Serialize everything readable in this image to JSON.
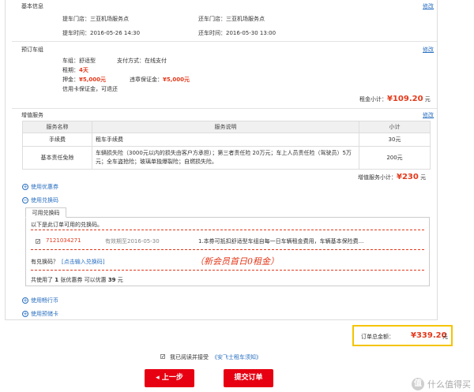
{
  "basic_info": {
    "title": "基本信息",
    "edit": "修改",
    "pickup_store": "提车门店：三亚机场服务点",
    "return_store": "还车门店：三亚机场服务点",
    "pickup_time": "提车时间：2016-05-26 14:30",
    "return_time": "还车时间：2016-05-30 13:00"
  },
  "vehicle": {
    "title": "预订车组",
    "edit": "修改",
    "group_label": "车组：",
    "group_value": "舒适型",
    "pay_label": "支付方式：",
    "pay_value": "在线支付",
    "lease_label": "租期：",
    "lease_value": "4天",
    "deposit_label": "押金：",
    "deposit_value": "¥5,000元",
    "violation_label": "违章保证金：",
    "violation_value": "¥5,000元",
    "note": "信用卡保证金，可退还",
    "subtotal_label": "租金小计：",
    "subtotal_value": "¥109.20",
    "subtotal_unit": "元"
  },
  "value_added": {
    "title": "增值服务",
    "edit": "修改",
    "headers": [
      "服务名称",
      "服务说明",
      "小计"
    ],
    "rows": [
      {
        "name": "手续费",
        "desc": "租车手续费",
        "price": "30元"
      },
      {
        "name": "基本责任免除",
        "desc": "车辆损失险（3000元以内的损失由客户方承担）；第三者责任险 20万元；车上人员责任险（驾驶员）5万元；全车盗抢险；玻璃单独爆裂险；自燃损失险。",
        "price": "200元"
      }
    ],
    "subtotal_label": "增值服务小计：",
    "subtotal_value": "¥230",
    "subtotal_unit": "元"
  },
  "coupons": {
    "use_coupon": "使用优惠券",
    "use_code": "使用兑换码",
    "tab_label": "可用兑换码",
    "intro": "以下是此订单可用的兑换码。",
    "code": "7121034271",
    "checked": true,
    "validity": "有效期至2016-05-30",
    "description": "1.本券可抵扣舒适型车组自每一日车辆租金费用，车辆基本保险费...",
    "has_code_label": "有兑换码？",
    "enter_code_link": "[点击输入兑换码]",
    "annotation": "（新会员首日0租金）",
    "summary_prefix": "共使用了",
    "summary_count": "1",
    "summary_middle": "张优惠券 可以优惠",
    "summary_amount": "39",
    "summary_unit": "元",
    "use_travel_coin": "使用畅行币",
    "use_prepaid_card": "使用预储卡"
  },
  "order_total": {
    "label": "订单总金额：",
    "value": "¥339.20",
    "unit": "元"
  },
  "agreement": {
    "checked": true,
    "text": "我已阅读并接受",
    "link": "《安飞士租车须知》"
  },
  "buttons": {
    "prev": "◂ 上一步",
    "submit": "提交订单"
  },
  "watermark": {
    "logo": "值",
    "text": "什么值得买"
  },
  "colors": {
    "accent_red": "#e60012",
    "price_red": "#e33a1c",
    "link_blue": "#2a6fc0",
    "highlight_yellow": "#f5c400"
  }
}
